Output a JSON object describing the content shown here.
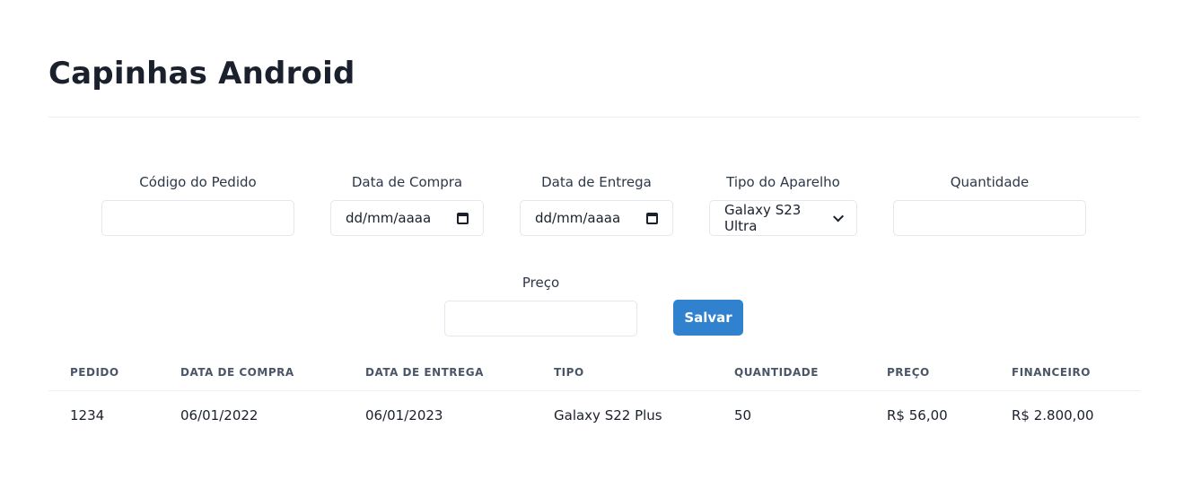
{
  "page": {
    "title": "Capinhas Android"
  },
  "form": {
    "codigo": {
      "label": "Código do Pedido",
      "value": ""
    },
    "data_compra": {
      "label": "Data de Compra",
      "value": "dd/mm/aaaa"
    },
    "data_entrega": {
      "label": "Data de Entrega",
      "value": "dd/mm/aaaa"
    },
    "tipo": {
      "label": "Tipo do Aparelho",
      "value": "Galaxy S23 Ultra"
    },
    "quantidade": {
      "label": "Quantidade",
      "value": ""
    },
    "preco": {
      "label": "Preço",
      "value": ""
    },
    "save_label": "Salvar"
  },
  "table": {
    "headers": [
      "PEDIDO",
      "DATA DE COMPRA",
      "DATA DE ENTREGA",
      "TIPO",
      "QUANTIDADE",
      "PREÇO",
      "FINANCEIRO"
    ],
    "rows": [
      [
        "1234",
        "06/01/2022",
        "06/01/2023",
        "Galaxy S22 Plus",
        "50",
        "R$ 56,00",
        "R$ 2.800,00"
      ]
    ]
  },
  "colors": {
    "accent": "#3182ce",
    "text": "#1a202c",
    "border": "#e2e8f0"
  }
}
